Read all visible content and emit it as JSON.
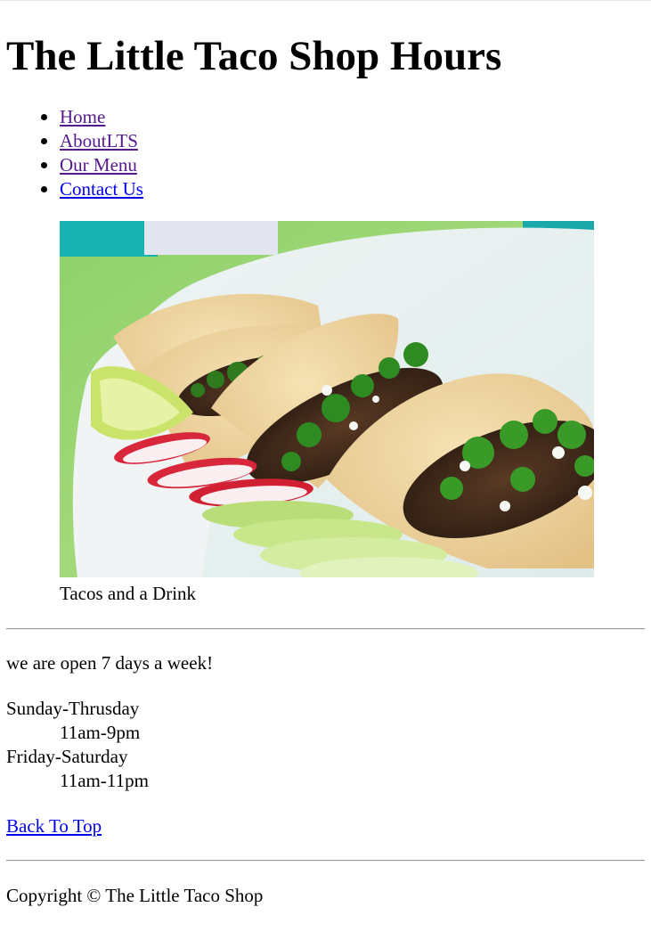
{
  "header": {
    "title": "The Little Taco Shop Hours"
  },
  "nav": {
    "items": [
      {
        "label": "Home"
      },
      {
        "label": "AboutLTS"
      },
      {
        "label": "Our Menu"
      },
      {
        "label": "Contact Us"
      }
    ]
  },
  "figure": {
    "caption": "Tacos and a Drink"
  },
  "hours": {
    "intro": "we are open 7 days a week!",
    "schedule": [
      {
        "days": "Sunday-Thrusday",
        "time": "11am-9pm"
      },
      {
        "days": "Friday-Saturday",
        "time": "11am-11pm"
      }
    ]
  },
  "back_to_top": "Back To Top",
  "footer": {
    "copyright": "Copyright © The Little Taco Shop"
  },
  "colors": {
    "link_visited": "#551a8b",
    "link_unvisited": "#0000ee",
    "rule": "#9a9a9a"
  }
}
